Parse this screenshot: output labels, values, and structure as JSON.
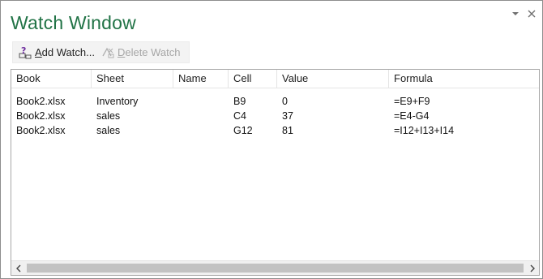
{
  "pane": {
    "title": "Watch Window",
    "accent_color": "#217346",
    "controls": [
      {
        "icon": "pane-options-icon",
        "glyph": "▾"
      },
      {
        "icon": "close-icon",
        "glyph": "×"
      }
    ]
  },
  "toolbar": {
    "add_watch": {
      "accel": "A",
      "rest": "dd Watch...",
      "icon": "add-watch-icon"
    },
    "delete_watch": {
      "accel": "D",
      "rest": "elete Watch",
      "icon": "delete-watch-icon",
      "disabled": true
    }
  },
  "table": {
    "columns": [
      "Book",
      "Sheet",
      "Name",
      "Cell",
      "Value",
      "Formula"
    ],
    "rows": [
      {
        "book": "Book2.xlsx",
        "sheet": "Inventory",
        "name": "",
        "cell": "B9",
        "value": "0",
        "formula": "=E9+F9"
      },
      {
        "book": "Book2.xlsx",
        "sheet": "sales",
        "name": "",
        "cell": "C4",
        "value": "37",
        "formula": "=E4-G4"
      },
      {
        "book": "Book2.xlsx",
        "sheet": "sales",
        "name": "",
        "cell": "G12",
        "value": "81",
        "formula": "=I12+I13+I14"
      }
    ]
  },
  "scrollbar": {
    "left_arrow": "‹",
    "right_arrow": "›"
  }
}
